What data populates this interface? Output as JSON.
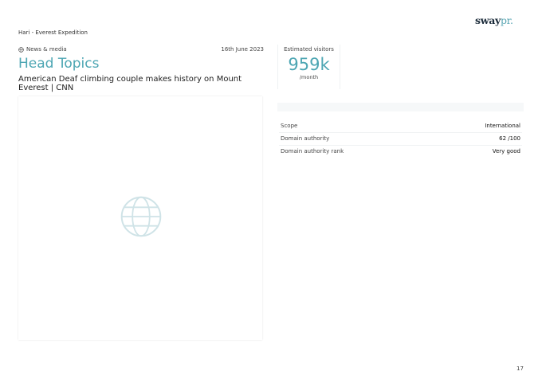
{
  "brand": {
    "logo_main": "sway",
    "logo_suffix": "pr."
  },
  "breadcrumb": "Hari - Everest Expedition",
  "article": {
    "category": "News & media",
    "date": "16th June 2023",
    "outlet": "Head Topics",
    "headline": "American Deaf climbing couple makes history on Mount Everest | CNN"
  },
  "visitors": {
    "label": "Estimated visitors",
    "value": "959k",
    "unit": "/month"
  },
  "info": [
    {
      "key": "Scope",
      "value": "International"
    },
    {
      "key": "Domain authority",
      "value": "62 /100"
    },
    {
      "key": "Domain authority rank",
      "value": "Very good"
    }
  ],
  "page_number": "17",
  "colors": {
    "accent": "#4da6b3",
    "logo_dark": "#1b2b3a"
  },
  "icons": {
    "category": "globe-icon",
    "preview_placeholder": "globe-icon"
  }
}
